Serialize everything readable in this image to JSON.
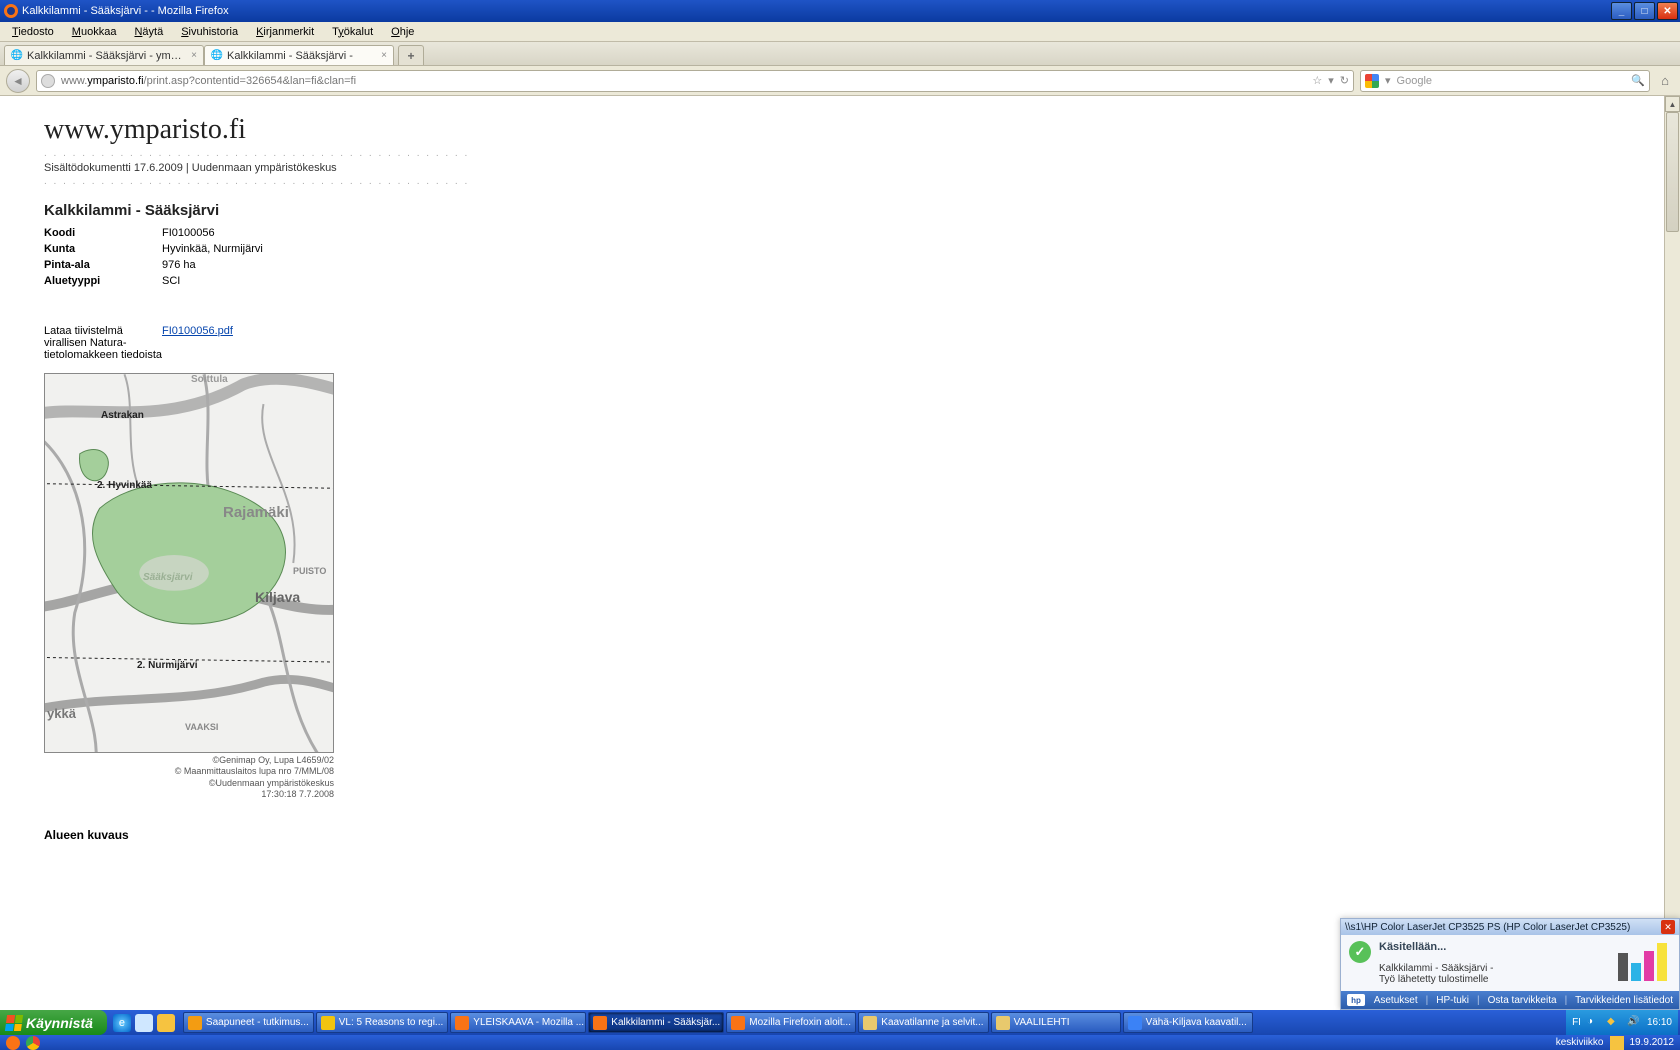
{
  "window_title": "Kalkkilammi - Sääksjärvi -  - Mozilla Firefox",
  "menu": [
    "Tiedosto",
    "Muokkaa",
    "Näytä",
    "Sivuhistoria",
    "Kirjanmerkit",
    "Työkalut",
    "Ohje"
  ],
  "tabs": [
    {
      "label": "Kalkkilammi - Sääksjärvi - ymparisto.fi",
      "active": false
    },
    {
      "label": "Kalkkilammi - Sääksjärvi -",
      "active": true
    }
  ],
  "url": {
    "prefix": "www.",
    "domain": "ymparisto.fi",
    "path": "/print.asp?contentid=326654&lan=fi&clan=fi"
  },
  "search_placeholder": "Google",
  "page": {
    "site": "www.ymparisto.fi",
    "meta": "Sisältödokumentti 17.6.2009   |   Uudenmaan ympäristökeskus",
    "title": "Kalkkilammi - Sääksjärvi",
    "kv": [
      {
        "k": "Koodi",
        "v": "FI0100056"
      },
      {
        "k": "Kunta",
        "v": "Hyvinkää, Nurmijärvi"
      },
      {
        "k": "Pinta-ala",
        "v": "976 ha"
      },
      {
        "k": "Aluetyyppi",
        "v": "SCI"
      }
    ],
    "dl_label": "Lataa tiivistelmä virallisen Natura-tietolomakkeen tiedoista",
    "dl_link": "FI0100056.pdf",
    "map_labels": {
      "astrakan": "Astrakan",
      "hyv": "2. Hyvinkää",
      "raj": "Rajamäki",
      "puisto": "PUISTO",
      "kiljava": "Kiljava",
      "saaks": "Sääksjärvi",
      "nurmi": "2. Nurmijärvi",
      "ykka": "ykkä",
      "vaaksi": "VAAKSI",
      "soittula": "Soittula"
    },
    "map_caption": [
      "©Genimap Oy, Lupa L4659/02",
      "© Maanmittauslaitos lupa nro 7/MML/08",
      "©Uudenmaan ympäristökeskus",
      "17:30:18 7.7.2008"
    ],
    "section": "Alueen kuvaus"
  },
  "toast": {
    "title": "\\\\s1\\HP Color LaserJet CP3525 PS (HP Color LaserJet CP3525)",
    "heading": "Käsitellään...",
    "line1": "Kalkkilammi - Sääksjärvi -",
    "line2": "Työ lähetetty tulostimelle",
    "footer": [
      "Asetukset",
      "HP-tuki",
      "Osta tarvikkeita",
      "Tarvikkeiden lisätiedot"
    ]
  },
  "taskbar": {
    "start": "Käynnistä",
    "tasks": [
      {
        "label": "Saapuneet - tutkimus...",
        "color": "#f39c12",
        "active": false
      },
      {
        "label": "VL: 5 Reasons to regi...",
        "color": "#f1c40f",
        "active": false
      },
      {
        "label": "YLEISKAAVA - Mozilla ...",
        "color": "#f97316",
        "active": false
      },
      {
        "label": "Kalkkilammi - Sääksjär...",
        "color": "#f97316",
        "active": true
      },
      {
        "label": "Mozilla Firefoxin aloit...",
        "color": "#f97316",
        "active": false
      },
      {
        "label": "Kaavatilanne ja selvit...",
        "color": "#e8c96d",
        "active": false
      },
      {
        "label": "VAALILEHTI",
        "color": "#e8c96d",
        "active": false
      },
      {
        "label": "Vähä-Kiljava kaavatil...",
        "color": "#3b82f6",
        "active": false
      }
    ],
    "lang": "FI",
    "clock_time": "16:10",
    "clock_day": "keskiviikko",
    "clock_date": "19.9.2012"
  }
}
